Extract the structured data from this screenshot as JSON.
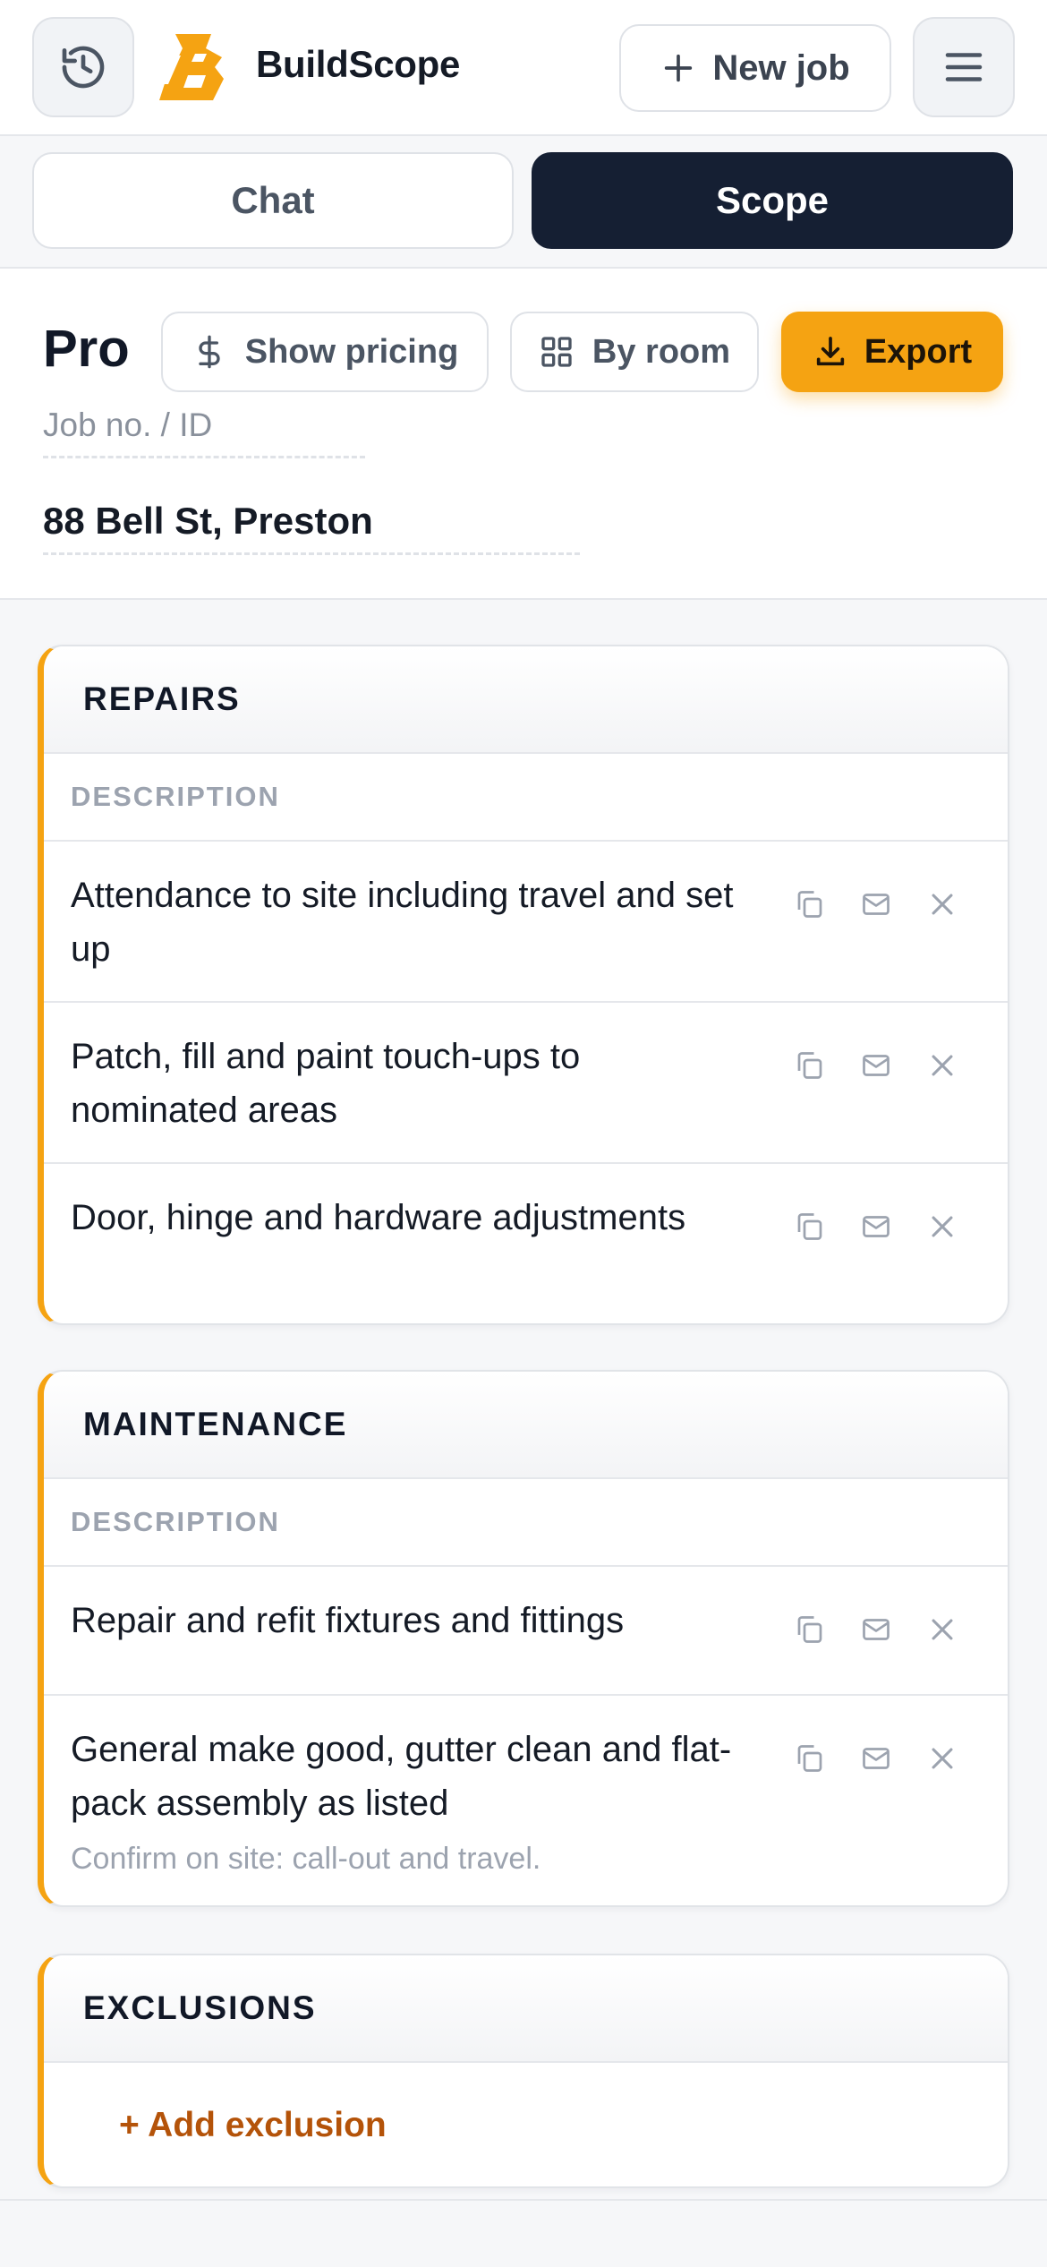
{
  "header": {
    "brand": "BuildScope",
    "new_job_label": "New job",
    "icons": {
      "history": "history-icon",
      "plus": "plus-icon",
      "menu": "menu-icon",
      "logo": "buildscope-logo"
    }
  },
  "tabs": [
    {
      "label": "Chat",
      "active": false
    },
    {
      "label": "Scope",
      "active": true
    }
  ],
  "job": {
    "tier": "Pro",
    "show_pricing_label": "Show pricing",
    "by_room_label": "By room",
    "export_label": "Export",
    "job_no_placeholder": "Job no. / ID",
    "address": "88 Bell St, Preston"
  },
  "sections": {
    "repairs": {
      "title": "REPAIRS",
      "column": "DESCRIPTION",
      "rows": [
        {
          "text": "Attendance to site including travel and set up"
        },
        {
          "text": "Patch, fill and paint touch-ups to nominated areas"
        },
        {
          "text": "Door, hinge and hardware adjustments"
        }
      ]
    },
    "maintenance": {
      "title": "MAINTENANCE",
      "column": "DESCRIPTION",
      "rows": [
        {
          "text": "Repair and refit fixtures and fittings"
        },
        {
          "text": "General make good, gutter clean and flat-pack assembly as listed",
          "note": "Confirm on site: call-out and travel."
        }
      ]
    },
    "exclusions": {
      "title": "EXCLUSIONS",
      "add_label": "+ Add exclusion"
    }
  },
  "colors": {
    "accent": "#f5a312",
    "dark": "#151f33",
    "link": "#b45309",
    "muted": "#9ca3af"
  }
}
